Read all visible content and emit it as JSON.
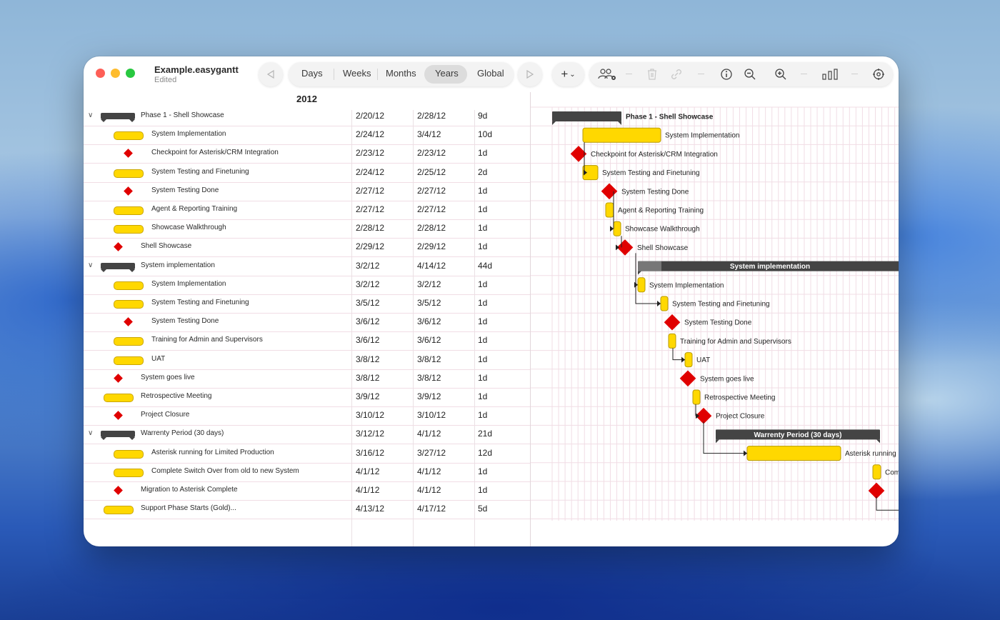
{
  "window": {
    "doc_title": "Example.easygantt",
    "doc_status": "Edited"
  },
  "toolbar": {
    "scale_options": [
      "Days",
      "Weeks",
      "Months",
      "Years",
      "Global"
    ],
    "selected_scale": "Years",
    "add_label": "+",
    "add_chevron": "⌄"
  },
  "timeline": {
    "year": "2012"
  },
  "tasks": [
    {
      "name": "Phase 1 - Shell Showcase",
      "start": "2/20/12",
      "end": "2/28/12",
      "duration": "9d",
      "kind": "summary",
      "level": 0,
      "expanded": true
    },
    {
      "name": "System Implementation",
      "start": "2/24/12",
      "end": "3/4/12",
      "duration": "10d",
      "kind": "task",
      "level": 1
    },
    {
      "name": "Checkpoint for Asterisk/CRM Integration",
      "start": "2/23/12",
      "end": "2/23/12",
      "duration": "1d",
      "kind": "milestone",
      "level": 1
    },
    {
      "name": "System Testing and Finetuning",
      "start": "2/24/12",
      "end": "2/25/12",
      "duration": "2d",
      "kind": "task",
      "level": 1
    },
    {
      "name": "System Testing Done",
      "start": "2/27/12",
      "end": "2/27/12",
      "duration": "1d",
      "kind": "milestone",
      "level": 1
    },
    {
      "name": "Agent & Reporting Training",
      "start": "2/27/12",
      "end": "2/27/12",
      "duration": "1d",
      "kind": "task",
      "level": 1
    },
    {
      "name": "Showcase Walkthrough",
      "start": "2/28/12",
      "end": "2/28/12",
      "duration": "1d",
      "kind": "task",
      "level": 1
    },
    {
      "name": "Shell Showcase",
      "start": "2/29/12",
      "end": "2/29/12",
      "duration": "1d",
      "kind": "milestone",
      "level": 0
    },
    {
      "name": "System implementation",
      "start": "3/2/12",
      "end": "4/14/12",
      "duration": "44d",
      "kind": "summary",
      "level": 0,
      "expanded": true
    },
    {
      "name": "System Implementation",
      "start": "3/2/12",
      "end": "3/2/12",
      "duration": "1d",
      "kind": "task",
      "level": 1
    },
    {
      "name": "System Testing and Finetuning",
      "start": "3/5/12",
      "end": "3/5/12",
      "duration": "1d",
      "kind": "task",
      "level": 1
    },
    {
      "name": "System Testing Done",
      "start": "3/6/12",
      "end": "3/6/12",
      "duration": "1d",
      "kind": "milestone",
      "level": 1
    },
    {
      "name": "Training for Admin and Supervisors",
      "start": "3/6/12",
      "end": "3/6/12",
      "duration": "1d",
      "kind": "task",
      "level": 1
    },
    {
      "name": "UAT",
      "start": "3/8/12",
      "end": "3/8/12",
      "duration": "1d",
      "kind": "task",
      "level": 1
    },
    {
      "name": "System goes live",
      "start": "3/8/12",
      "end": "3/8/12",
      "duration": "1d",
      "kind": "milestone",
      "level": 0
    },
    {
      "name": "Retrospective Meeting",
      "start": "3/9/12",
      "end": "3/9/12",
      "duration": "1d",
      "kind": "task",
      "level": 0
    },
    {
      "name": "Project Closure",
      "start": "3/10/12",
      "end": "3/10/12",
      "duration": "1d",
      "kind": "milestone",
      "level": 0
    },
    {
      "name": "Warrenty Period (30 days)",
      "start": "3/12/12",
      "end": "4/1/12",
      "duration": "21d",
      "kind": "summary",
      "level": 0,
      "expanded": true
    },
    {
      "name": "Asterisk running for Limited Production",
      "start": "3/16/12",
      "end": "3/27/12",
      "duration": "12d",
      "kind": "task",
      "level": 1
    },
    {
      "name": "Complete Switch Over from old to new System",
      "start": "4/1/12",
      "end": "4/1/12",
      "duration": "1d",
      "kind": "task",
      "level": 1
    },
    {
      "name": "Migration to Asterisk Complete",
      "start": "4/1/12",
      "end": "4/1/12",
      "duration": "1d",
      "kind": "milestone",
      "level": 0
    },
    {
      "name": "Support Phase Starts (Gold)...",
      "start": "4/13/12",
      "end": "4/17/12",
      "duration": "5d",
      "kind": "task",
      "level": 0
    }
  ],
  "gantt": {
    "summary_labels": {
      "phase1": "Phase 1 - Shell Showcase",
      "sysimpl": "System implementation",
      "warranty": "Warrenty Period (30 days)"
    },
    "bar_labels": [
      "System Implementation",
      "Checkpoint for Asterisk/CRM Integration",
      "System Testing and Finetuning",
      "System Testing Done",
      "Agent & Reporting Training",
      "Showcase Walkthrough",
      "Shell Showcase",
      "System Implementation",
      "System Testing and Finetuning",
      "System Testing Done",
      "Training for Admin and Supervisors",
      "UAT",
      "System goes live",
      "Retrospective Meeting",
      "Project Closure",
      "Asterisk running",
      "Com"
    ]
  },
  "colors": {
    "task_fill": "#ffd800",
    "milestone_fill": "#e00000",
    "summary_fill": "#444444",
    "grid_line": "#f1dde5"
  }
}
